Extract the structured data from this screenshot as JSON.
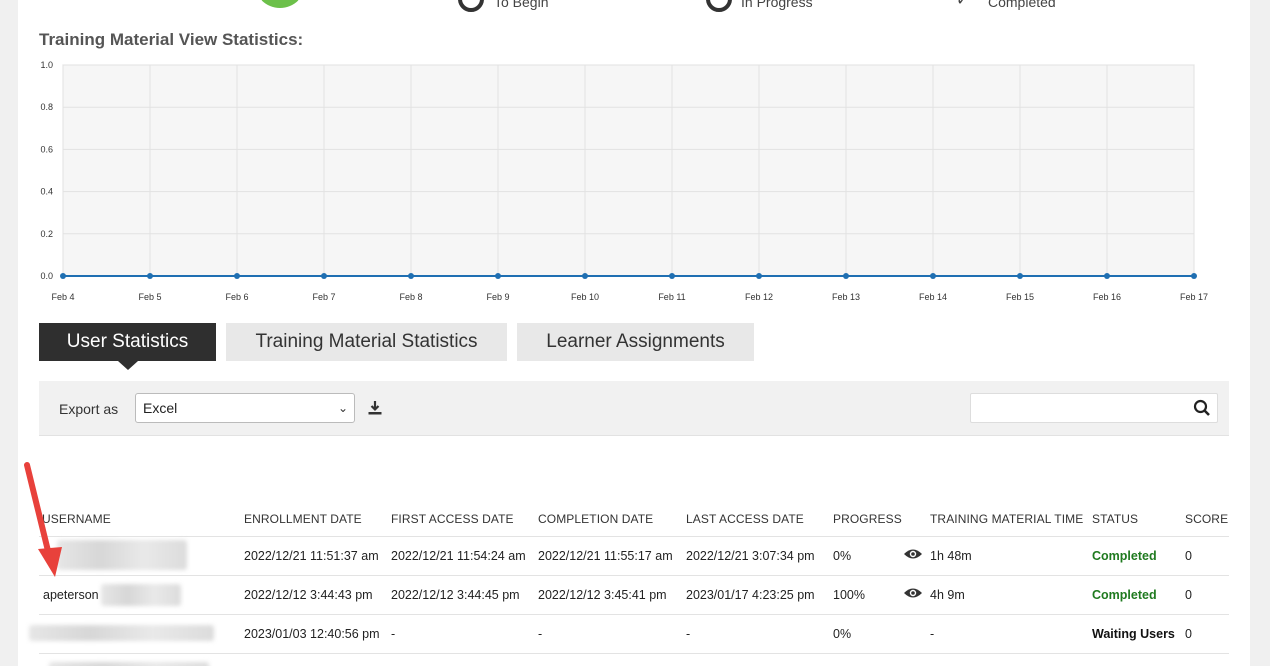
{
  "top_stats": [
    {
      "label": "To Begin"
    },
    {
      "label": "In Progress"
    },
    {
      "label": "Completed"
    }
  ],
  "chart_title": "Training Material View Statistics:",
  "chart_data": {
    "type": "line",
    "title": "Training Material View Statistics:",
    "x": [
      "Feb 4",
      "Feb 5",
      "Feb 6",
      "Feb 7",
      "Feb 8",
      "Feb 9",
      "Feb 10",
      "Feb 11",
      "Feb 12",
      "Feb 13",
      "Feb 14",
      "Feb 15",
      "Feb 16",
      "Feb 17"
    ],
    "values": [
      0,
      0,
      0,
      0,
      0,
      0,
      0,
      0,
      0,
      0,
      0,
      0,
      0,
      0
    ],
    "y_ticks": [
      "1.0",
      "0.8",
      "0.6",
      "0.4",
      "0.2",
      "0.0"
    ],
    "ylim": [
      0,
      1.0
    ],
    "grid": true,
    "color": "#1f6fb2"
  },
  "tabs": [
    {
      "label": "User Statistics",
      "active": true
    },
    {
      "label": "Training Material Statistics",
      "active": false
    },
    {
      "label": "Learner Assignments",
      "active": false
    }
  ],
  "toolbar": {
    "export_label": "Export as",
    "export_value": "Excel",
    "search_placeholder": ""
  },
  "table": {
    "headers": [
      "USERNAME",
      "ENROLLMENT DATE",
      "FIRST ACCESS DATE",
      "COMPLETION DATE",
      "LAST ACCESS DATE",
      "PROGRESS",
      "TRAINING MATERIAL TIME",
      "STATUS",
      "SCORE"
    ],
    "rows": [
      {
        "username": "",
        "enrollment": "2022/12/21 11:51:37 am",
        "first_access": "2022/12/21 11:54:24 am",
        "completion": "2022/12/21 11:55:17 am",
        "last_access": "2022/12/21 3:07:34 pm",
        "progress": "0%",
        "time": "1h 48m",
        "status": "Completed",
        "score": "0"
      },
      {
        "username": "apeterson",
        "enrollment": "2022/12/12 3:44:43 pm",
        "first_access": "2022/12/12 3:44:45 pm",
        "completion": "2022/12/12 3:45:41 pm",
        "last_access": "2023/01/17 4:23:25 pm",
        "progress": "100%",
        "time": "4h 9m",
        "status": "Completed",
        "score": "0"
      },
      {
        "username": "",
        "enrollment": "2023/01/03 12:40:56 pm",
        "first_access": "-",
        "completion": "-",
        "last_access": "-",
        "progress": "0%",
        "time": "-",
        "status": "Waiting Users",
        "score": "0"
      }
    ]
  },
  "colors": {
    "accent_dark": "#2f2f2f",
    "completed": "#1f7a1f",
    "line": "#1f6fb2",
    "arrow": "#e8413b"
  }
}
